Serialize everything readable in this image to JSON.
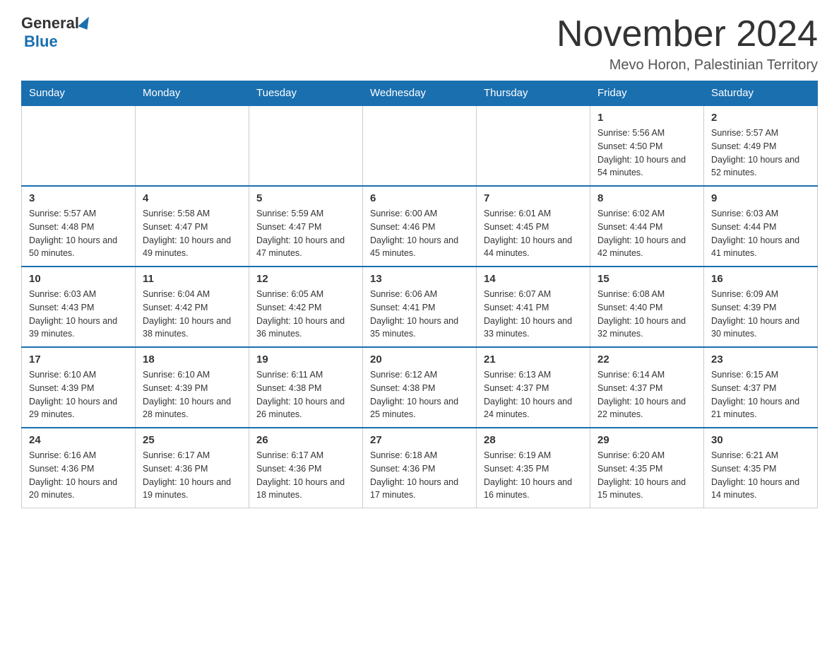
{
  "logo": {
    "part1": "General",
    "part2": "Blue"
  },
  "title": "November 2024",
  "subtitle": "Mevo Horon, Palestinian Territory",
  "days_of_week": [
    "Sunday",
    "Monday",
    "Tuesday",
    "Wednesday",
    "Thursday",
    "Friday",
    "Saturday"
  ],
  "weeks": [
    [
      {
        "day": "",
        "info": ""
      },
      {
        "day": "",
        "info": ""
      },
      {
        "day": "",
        "info": ""
      },
      {
        "day": "",
        "info": ""
      },
      {
        "day": "",
        "info": ""
      },
      {
        "day": "1",
        "info": "Sunrise: 5:56 AM\nSunset: 4:50 PM\nDaylight: 10 hours and 54 minutes."
      },
      {
        "day": "2",
        "info": "Sunrise: 5:57 AM\nSunset: 4:49 PM\nDaylight: 10 hours and 52 minutes."
      }
    ],
    [
      {
        "day": "3",
        "info": "Sunrise: 5:57 AM\nSunset: 4:48 PM\nDaylight: 10 hours and 50 minutes."
      },
      {
        "day": "4",
        "info": "Sunrise: 5:58 AM\nSunset: 4:47 PM\nDaylight: 10 hours and 49 minutes."
      },
      {
        "day": "5",
        "info": "Sunrise: 5:59 AM\nSunset: 4:47 PM\nDaylight: 10 hours and 47 minutes."
      },
      {
        "day": "6",
        "info": "Sunrise: 6:00 AM\nSunset: 4:46 PM\nDaylight: 10 hours and 45 minutes."
      },
      {
        "day": "7",
        "info": "Sunrise: 6:01 AM\nSunset: 4:45 PM\nDaylight: 10 hours and 44 minutes."
      },
      {
        "day": "8",
        "info": "Sunrise: 6:02 AM\nSunset: 4:44 PM\nDaylight: 10 hours and 42 minutes."
      },
      {
        "day": "9",
        "info": "Sunrise: 6:03 AM\nSunset: 4:44 PM\nDaylight: 10 hours and 41 minutes."
      }
    ],
    [
      {
        "day": "10",
        "info": "Sunrise: 6:03 AM\nSunset: 4:43 PM\nDaylight: 10 hours and 39 minutes."
      },
      {
        "day": "11",
        "info": "Sunrise: 6:04 AM\nSunset: 4:42 PM\nDaylight: 10 hours and 38 minutes."
      },
      {
        "day": "12",
        "info": "Sunrise: 6:05 AM\nSunset: 4:42 PM\nDaylight: 10 hours and 36 minutes."
      },
      {
        "day": "13",
        "info": "Sunrise: 6:06 AM\nSunset: 4:41 PM\nDaylight: 10 hours and 35 minutes."
      },
      {
        "day": "14",
        "info": "Sunrise: 6:07 AM\nSunset: 4:41 PM\nDaylight: 10 hours and 33 minutes."
      },
      {
        "day": "15",
        "info": "Sunrise: 6:08 AM\nSunset: 4:40 PM\nDaylight: 10 hours and 32 minutes."
      },
      {
        "day": "16",
        "info": "Sunrise: 6:09 AM\nSunset: 4:39 PM\nDaylight: 10 hours and 30 minutes."
      }
    ],
    [
      {
        "day": "17",
        "info": "Sunrise: 6:10 AM\nSunset: 4:39 PM\nDaylight: 10 hours and 29 minutes."
      },
      {
        "day": "18",
        "info": "Sunrise: 6:10 AM\nSunset: 4:39 PM\nDaylight: 10 hours and 28 minutes."
      },
      {
        "day": "19",
        "info": "Sunrise: 6:11 AM\nSunset: 4:38 PM\nDaylight: 10 hours and 26 minutes."
      },
      {
        "day": "20",
        "info": "Sunrise: 6:12 AM\nSunset: 4:38 PM\nDaylight: 10 hours and 25 minutes."
      },
      {
        "day": "21",
        "info": "Sunrise: 6:13 AM\nSunset: 4:37 PM\nDaylight: 10 hours and 24 minutes."
      },
      {
        "day": "22",
        "info": "Sunrise: 6:14 AM\nSunset: 4:37 PM\nDaylight: 10 hours and 22 minutes."
      },
      {
        "day": "23",
        "info": "Sunrise: 6:15 AM\nSunset: 4:37 PM\nDaylight: 10 hours and 21 minutes."
      }
    ],
    [
      {
        "day": "24",
        "info": "Sunrise: 6:16 AM\nSunset: 4:36 PM\nDaylight: 10 hours and 20 minutes."
      },
      {
        "day": "25",
        "info": "Sunrise: 6:17 AM\nSunset: 4:36 PM\nDaylight: 10 hours and 19 minutes."
      },
      {
        "day": "26",
        "info": "Sunrise: 6:17 AM\nSunset: 4:36 PM\nDaylight: 10 hours and 18 minutes."
      },
      {
        "day": "27",
        "info": "Sunrise: 6:18 AM\nSunset: 4:36 PM\nDaylight: 10 hours and 17 minutes."
      },
      {
        "day": "28",
        "info": "Sunrise: 6:19 AM\nSunset: 4:35 PM\nDaylight: 10 hours and 16 minutes."
      },
      {
        "day": "29",
        "info": "Sunrise: 6:20 AM\nSunset: 4:35 PM\nDaylight: 10 hours and 15 minutes."
      },
      {
        "day": "30",
        "info": "Sunrise: 6:21 AM\nSunset: 4:35 PM\nDaylight: 10 hours and 14 minutes."
      }
    ]
  ]
}
